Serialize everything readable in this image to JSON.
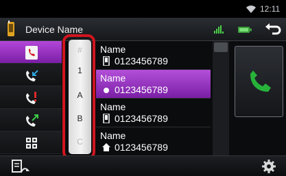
{
  "status": {
    "time": "12:11"
  },
  "header": {
    "title": "Device Name"
  },
  "tabs": [
    {
      "icon": "phonebook-icon",
      "active": true
    },
    {
      "icon": "incoming-call-icon",
      "active": false
    },
    {
      "icon": "missed-call-icon",
      "active": false
    },
    {
      "icon": "outgoing-call-icon",
      "active": false
    },
    {
      "icon": "dialpad-icon",
      "active": false
    }
  ],
  "index": [
    "#",
    "1",
    "A",
    "B",
    "C"
  ],
  "contacts": [
    {
      "name": "Name",
      "number": "0123456789",
      "type_icon": "mobile-icon",
      "selected": false
    },
    {
      "name": "Name",
      "number": "0123456789",
      "type_icon": "general-icon",
      "selected": true
    },
    {
      "name": "Name",
      "number": "0123456789",
      "type_icon": "mobile-icon",
      "selected": false
    },
    {
      "name": "Name",
      "number": "0123456789",
      "type_icon": "home-icon",
      "selected": false
    }
  ],
  "colors": {
    "accent": "#9b34c4",
    "call_green": "#27b33a",
    "highlight": "#d0151f"
  }
}
